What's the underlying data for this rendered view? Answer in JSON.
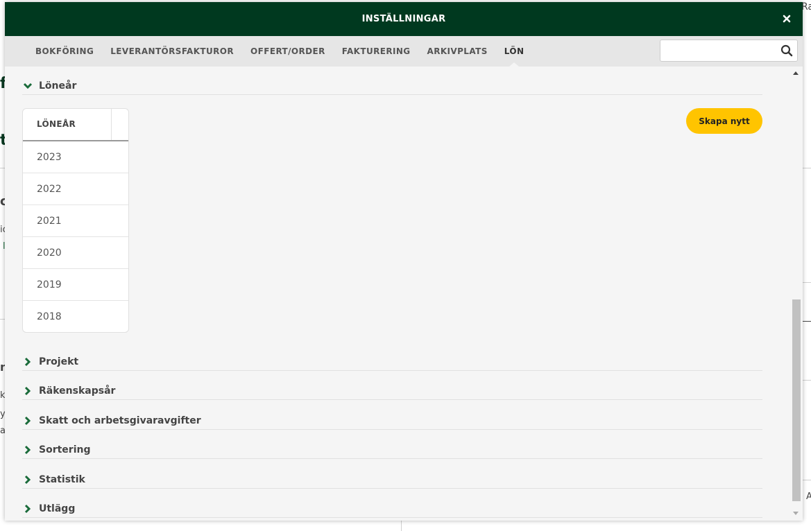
{
  "modal": {
    "title": "INSTÄLLNINGAR",
    "close_icon": "close-icon"
  },
  "nav": {
    "tabs": [
      {
        "label": "BOKFÖRING"
      },
      {
        "label": "LEVERANTÖRSFAKTUROR"
      },
      {
        "label": "OFFERT/ORDER"
      },
      {
        "label": "FAKTURERING"
      },
      {
        "label": "ARKIVPLATS"
      },
      {
        "label": "LÖN"
      }
    ],
    "active_tab": "LÖN",
    "search": {
      "value": "",
      "placeholder": "",
      "icon": "search-icon"
    }
  },
  "expanded_section": {
    "label": "Löneår",
    "table": {
      "header": "LÖNEÅR",
      "rows": [
        "2023",
        "2022",
        "2021",
        "2020",
        "2019",
        "2018"
      ]
    },
    "create_button": "Skapa nytt"
  },
  "collapsed_sections": [
    "Projekt",
    "Räkenskapsår",
    "Skatt och arbetsgivaravgifter",
    "Sortering",
    "Statistik",
    "Utlägg"
  ],
  "background_fragments": [
    "Ra",
    "f",
    "t",
    "c",
    "ic",
    "l",
    "n",
    "k",
    "y",
    "at",
    "A"
  ],
  "colors": {
    "header_bg": "#00391f",
    "accent_green": "#1a6b3a",
    "button_yellow": "#ffc400",
    "nav_bg": "#e6e6e6",
    "content_bg": "#f5f5f5"
  }
}
